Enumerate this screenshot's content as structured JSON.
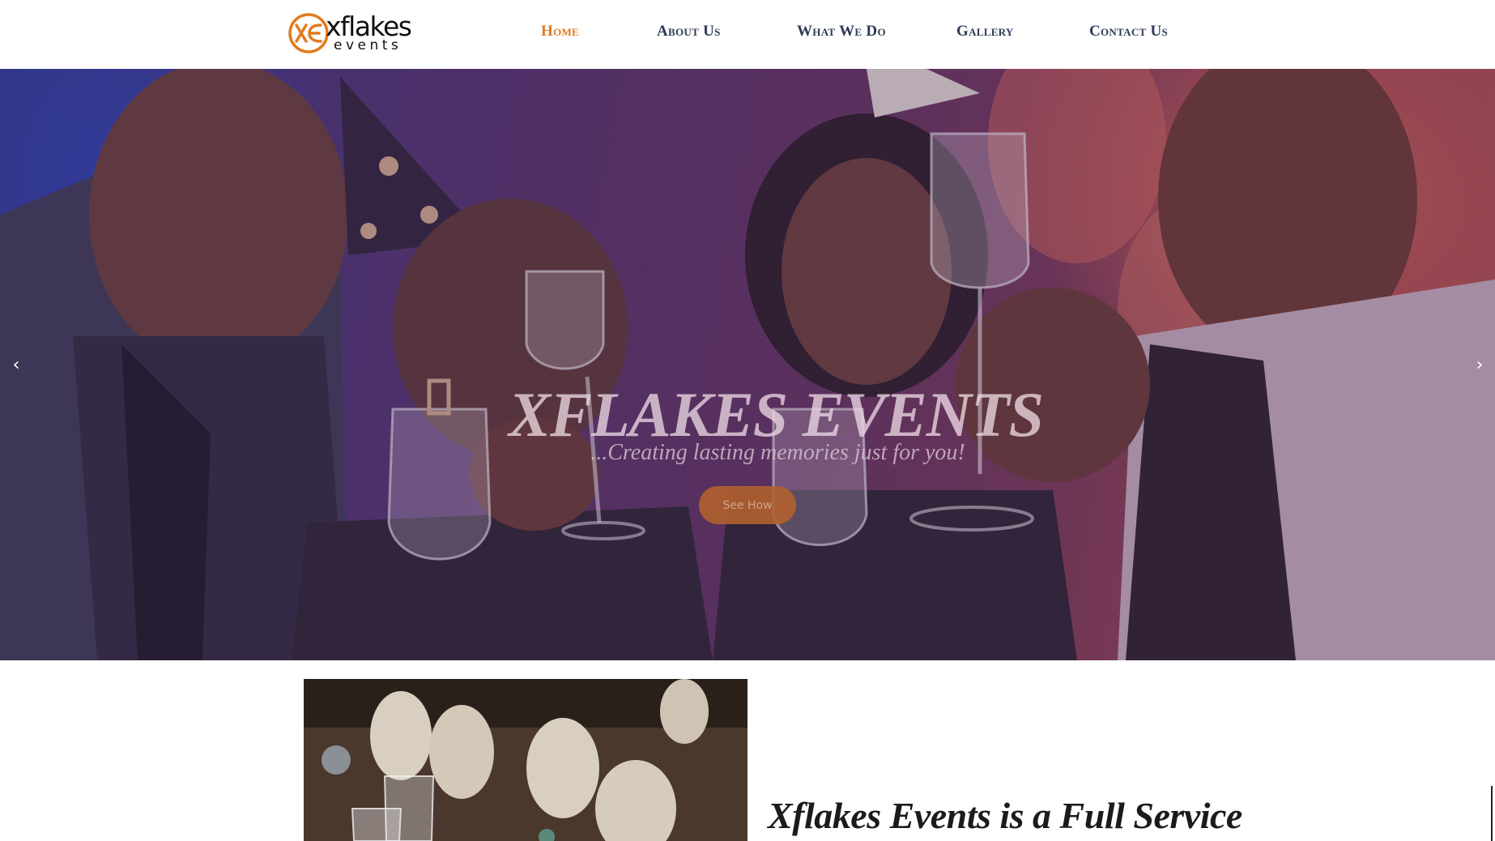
{
  "brand": {
    "name": "xflakes",
    "sub": "events",
    "accent_color": "#e07b1f",
    "nav_color": "#2e3a59"
  },
  "nav": {
    "items": [
      {
        "label": "Home",
        "active": true
      },
      {
        "label": "About Us",
        "active": false
      },
      {
        "label": "What We Do",
        "active": false
      },
      {
        "label": "Gallery",
        "active": false
      },
      {
        "label": "Contact Us",
        "active": false
      }
    ]
  },
  "hero": {
    "title": "XFLAKES EVENTS",
    "tagline": "...Creating lasting memories just for you!",
    "cta_label": "See How",
    "prev_icon": "chevron-left-icon",
    "next_icon": "chevron-right-icon"
  },
  "about": {
    "heading": "Xflakes Events is a Full Service"
  }
}
